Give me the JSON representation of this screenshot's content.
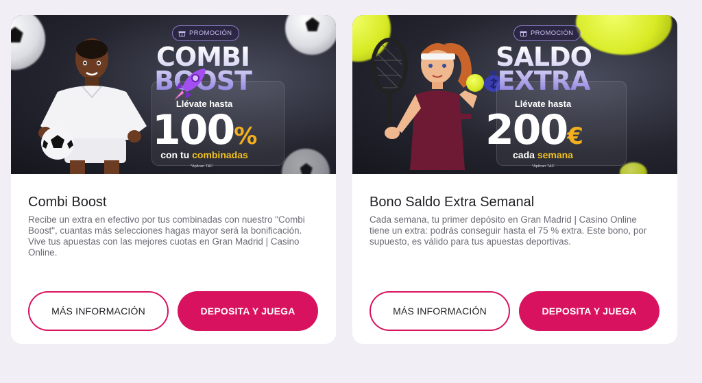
{
  "colors": {
    "brand": "#d8125f",
    "promo_yellow": "#f2c21e",
    "banner_dark": "#1d1e27"
  },
  "cards": [
    {
      "banner": {
        "badge": "PROMOCIÓN",
        "headline_1": "COMBI",
        "headline_2": "BOOST",
        "subline": "Llévate hasta",
        "amount": "100",
        "unit": "%",
        "foot_prefix": "con tu ",
        "foot_accent": "combinadas",
        "tc": "*Aplican T&C",
        "character": "soccer-player",
        "ball": "soccer-ball-icon"
      },
      "title": "Combi Boost",
      "description": "Recibe un extra en efectivo por tus combinadas con nuestro \"Combi Boost\", cuantas más selecciones hagas mayor será la bonificación. Vive tus apuestas con las mejores cuotas en Gran Madrid | Casino Online.",
      "info_label": "MÁS INFORMACIÓN",
      "deposit_label": "DEPOSITA Y JUEGA"
    },
    {
      "banner": {
        "badge": "PROMOCIÓN",
        "headline_1": "SALDO",
        "headline_2": "EXTRA",
        "subline": "Llévate hasta",
        "amount": "200",
        "unit": "€",
        "foot_prefix": "cada ",
        "foot_accent": "semana",
        "tc": "*Aplican T&C",
        "character": "tennis-player",
        "ball": "tennis-ball-icon"
      },
      "title": "Bono Saldo Extra Semanal",
      "description": "Cada semana, tu primer depósito en Gran Madrid | Casino Online tiene un extra: podrás conseguir hasta el 75 % extra. Este bono, por supuesto, es válido para tus apuestas deportivas.",
      "info_label": "MÁS INFORMACIÓN",
      "deposit_label": "DEPOSITA Y JUEGA"
    }
  ]
}
